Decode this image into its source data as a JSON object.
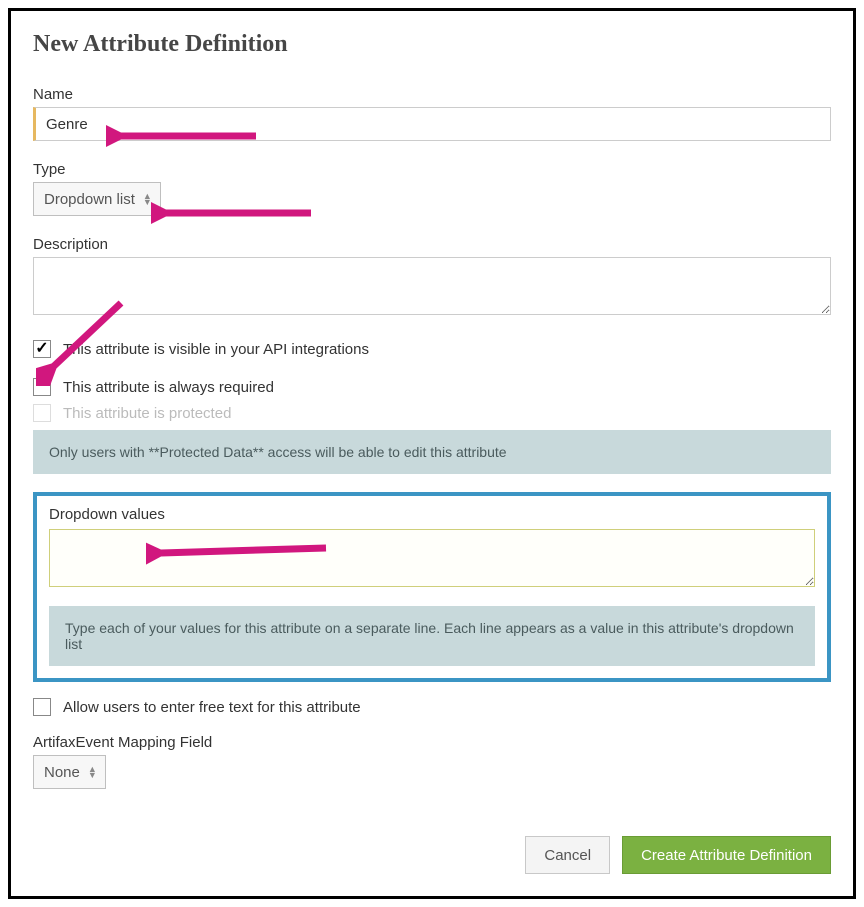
{
  "title": "New Attribute Definition",
  "name": {
    "label": "Name",
    "value": "Genre"
  },
  "type": {
    "label": "Type",
    "value": "Dropdown list"
  },
  "description": {
    "label": "Description",
    "value": ""
  },
  "checkboxes": {
    "api_visible": {
      "label": "This attribute is visible in your API integrations",
      "checked": true
    },
    "always_required": {
      "label": "This attribute is always required",
      "checked": false
    },
    "protected": {
      "label": "This attribute is protected",
      "checked": false,
      "disabled": true
    }
  },
  "protected_note": "Only users with **Protected Data** access will be able to edit this attribute",
  "dropdown_values": {
    "label": "Dropdown values",
    "value": "",
    "hint": "Type each of your values for this attribute on a separate line. Each line appears as a value in this attribute's dropdown list"
  },
  "free_text": {
    "label": "Allow users to enter free text for this attribute",
    "checked": false
  },
  "mapping": {
    "label": "ArtifaxEvent Mapping Field",
    "value": "None"
  },
  "buttons": {
    "cancel": "Cancel",
    "submit": "Create Attribute Definition"
  },
  "annotation_color": "#d1177e"
}
